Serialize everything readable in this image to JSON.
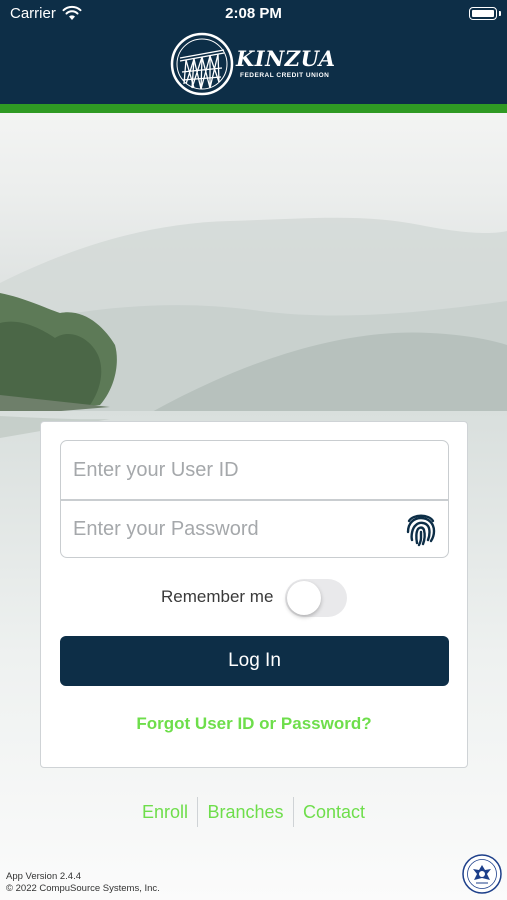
{
  "status_bar": {
    "carrier": "Carrier",
    "time": "2:08 PM"
  },
  "header": {
    "logo_name": "KINZUA",
    "logo_subtitle": "FEDERAL CREDIT UNION",
    "brand_color": "#0d2e47",
    "accent_color": "#2f9a23"
  },
  "login": {
    "user_id_placeholder": "Enter your User ID",
    "password_placeholder": "Enter your Password",
    "remember_label": "Remember me",
    "remember_on": false,
    "login_button": "Log In",
    "forgot_link": "Forgot User ID or Password?"
  },
  "links": {
    "enroll": "Enroll",
    "branches": "Branches",
    "contact": "Contact",
    "link_color": "#6ede4b"
  },
  "footer": {
    "version": "App Version 2.4.4",
    "copyright": "© 2022 CompuSource Systems, Inc."
  },
  "icons": [
    "wifi-icon",
    "battery-icon",
    "fingerprint-icon",
    "ncua-seal-icon"
  ]
}
